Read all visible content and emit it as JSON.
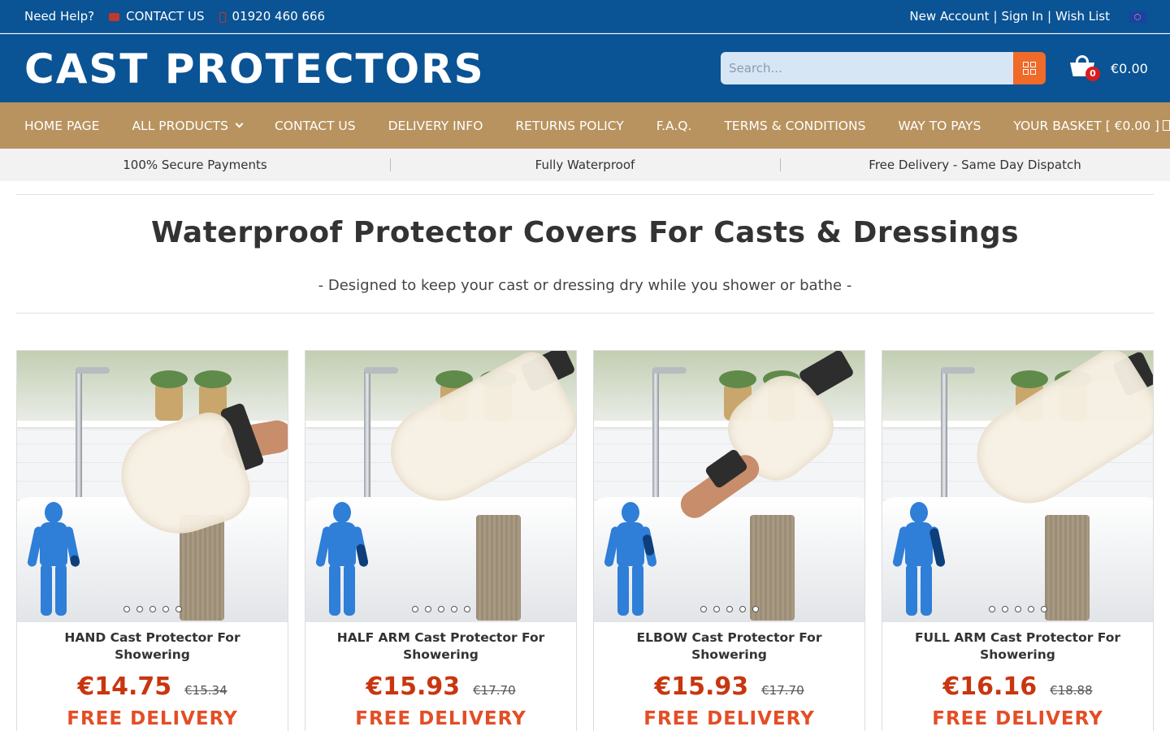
{
  "topbar": {
    "help": "Need Help?",
    "contact": "CONTACT US",
    "phone": "01920 460 666",
    "new_account": "New Account",
    "sign_in": "Sign In",
    "wish_list": "Wish List",
    "separator": "|"
  },
  "header": {
    "logo": "CAST PROTECTORS",
    "search_placeholder": "Search...",
    "cart_count": "0",
    "cart_total": "€0.00"
  },
  "nav": {
    "items": [
      "HOME PAGE",
      "ALL PRODUCTS",
      "CONTACT US",
      "DELIVERY INFO",
      "RETURNS POLICY",
      "F.A.Q.",
      "TERMS & CONDITIONS",
      "WAY TO PAYS",
      "YOUR BASKET [ €0.00 ]"
    ]
  },
  "infobar": [
    "100% Secure Payments",
    "Fully Waterproof",
    "Free Delivery - Same Day Dispatch"
  ],
  "main": {
    "title": "Waterproof Protector Covers For Casts & Dressings",
    "subtitle": "- Designed to keep your cast or dressing dry while you shower or bathe -"
  },
  "products": [
    {
      "name": "HAND Cast Protector For Showering",
      "price": "€14.75",
      "old_price": "€15.34",
      "delivery": "FREE DELIVERY"
    },
    {
      "name": "HALF ARM Cast Protector For Showering",
      "price": "€15.93",
      "old_price": "€17.70",
      "delivery": "FREE DELIVERY"
    },
    {
      "name": "ELBOW Cast Protector For Showering",
      "price": "€15.93",
      "old_price": "€17.70",
      "delivery": "FREE DELIVERY"
    },
    {
      "name": "FULL ARM Cast Protector For Showering",
      "price": "€16.16",
      "old_price": "€18.88",
      "delivery": "FREE DELIVERY"
    }
  ],
  "colors": {
    "brand_blue": "#0a5394",
    "nav_gold": "#b8935f",
    "search_button": "#f06a2a",
    "price_red": "#c8360f",
    "figure_blue": "#2f7ed8"
  },
  "icons": {
    "contact": "envelope-icon",
    "phone": "phone-icon",
    "language": "eu-flag-icon",
    "search": "grid-search-icon",
    "cart": "basket-icon",
    "dropdown": "chevron-down-icon",
    "basket_nav": "bag-icon"
  }
}
